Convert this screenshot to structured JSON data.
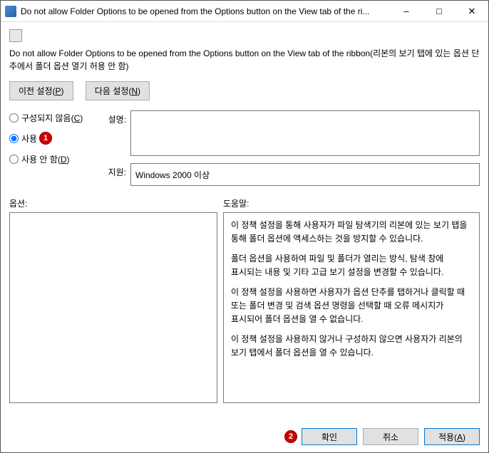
{
  "window": {
    "title": "Do not allow Folder Options to be opened from the Options button on the View tab of the ri..."
  },
  "policy": {
    "title": "Do not allow Folder Options to be opened from the Options button on the View tab of the ribbon(리본의 보기 탭에 있는 옵션 단추에서 폴더 옵션 열기 허용 안 함)"
  },
  "nav": {
    "prev_label_text": "이전 설정",
    "prev_label_key": "P",
    "next_label_text": "다음 설정",
    "next_label_key": "N"
  },
  "radios": {
    "not_configured_text": "구성되지 않음",
    "not_configured_key": "C",
    "enabled_text": "사용",
    "enabled_key": "E",
    "disabled_text": "사용 안 함",
    "disabled_key": "D",
    "selected": "enabled"
  },
  "fields": {
    "desc_label": "설명:",
    "desc_value": "",
    "support_label": "지원:",
    "support_value": "Windows 2000 이상"
  },
  "lower": {
    "options_label": "옵션:",
    "help_label": "도움말:"
  },
  "help": {
    "p1": "이 정책 설정을 통해 사용자가 파일 탐색기의 리본에 있는 보기 탭을 통해 폴더 옵션에 액세스하는 것을 방지할 수 있습니다.",
    "p2": "폴더 옵션을 사용하여 파일 및 폴더가 열리는 방식, 탐색 창에 표시되는 내용 및 기타 고급 보기 설정을 변경할 수 있습니다.",
    "p3": "이 정책 설정을 사용하면 사용자가 옵션 단추를 탭하거나 클릭할 때 또는 폴더 변경 및 검색 옵션 명령을 선택할 때 오류 메시지가 표시되어 폴더 옵션을 열 수 없습니다.",
    "p4": "이 정책 설정을 사용하지 않거나 구성하지 않으면 사용자가 리본의 보기 탭에서 폴더 옵션을 열 수 있습니다."
  },
  "footer": {
    "ok": "확인",
    "cancel": "취소",
    "apply_text": "적용",
    "apply_key": "A"
  },
  "annotations": {
    "badge1": "1",
    "badge2": "2"
  }
}
